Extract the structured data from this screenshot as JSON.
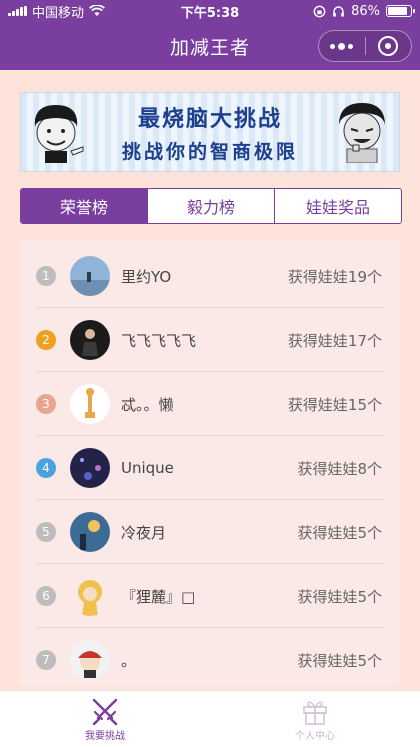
{
  "status_bar": {
    "carrier": "中国移动",
    "time": "下午5:38",
    "battery": "86%",
    "battery_level": 0.86
  },
  "nav": {
    "title": "加减王者"
  },
  "banner": {
    "title": "最烧脑大挑战",
    "subtitle": "挑战你的智商极限"
  },
  "tabs": [
    {
      "label": "荣誉榜",
      "active": true
    },
    {
      "label": "毅力榜",
      "active": false
    },
    {
      "label": "娃娃奖品",
      "active": false
    }
  ],
  "leaderboard": [
    {
      "rank": "1",
      "name": "里约YO",
      "prize": "获得娃娃19个",
      "rank_color": "#bdbdbd",
      "avatar": "landscape-avatar"
    },
    {
      "rank": "2",
      "name": "飞飞飞飞飞",
      "prize": "获得娃娃17个",
      "rank_color": "#f0a020",
      "avatar": "person-avatar"
    },
    {
      "rank": "3",
      "name": "忒。。懒",
      "prize": "获得娃娃15个",
      "rank_color": "#e8a48e",
      "avatar": "giraffe-avatar"
    },
    {
      "rank": "4",
      "name": "Unique",
      "prize": "获得娃娃8个",
      "rank_color": "#4aa3df",
      "avatar": "night-avatar"
    },
    {
      "rank": "5",
      "name": "冷夜月",
      "prize": "获得娃娃5个",
      "rank_color": "#bdbdbd",
      "avatar": "sunset-avatar"
    },
    {
      "rank": "6",
      "name": "『狸麓』□",
      "prize": "获得娃娃5个",
      "rank_color": "#bdbdbd",
      "avatar": "girl-avatar"
    },
    {
      "rank": "7",
      "name": "。",
      "prize": "获得娃娃5个",
      "rank_color": "#bdbdbd",
      "avatar": "cartoon-avatar"
    }
  ],
  "tabbar": {
    "challenge": "我要挑战",
    "profile": "个人中心"
  },
  "colors": {
    "brand": "#7a3f9e",
    "background": "#fde3d9"
  }
}
